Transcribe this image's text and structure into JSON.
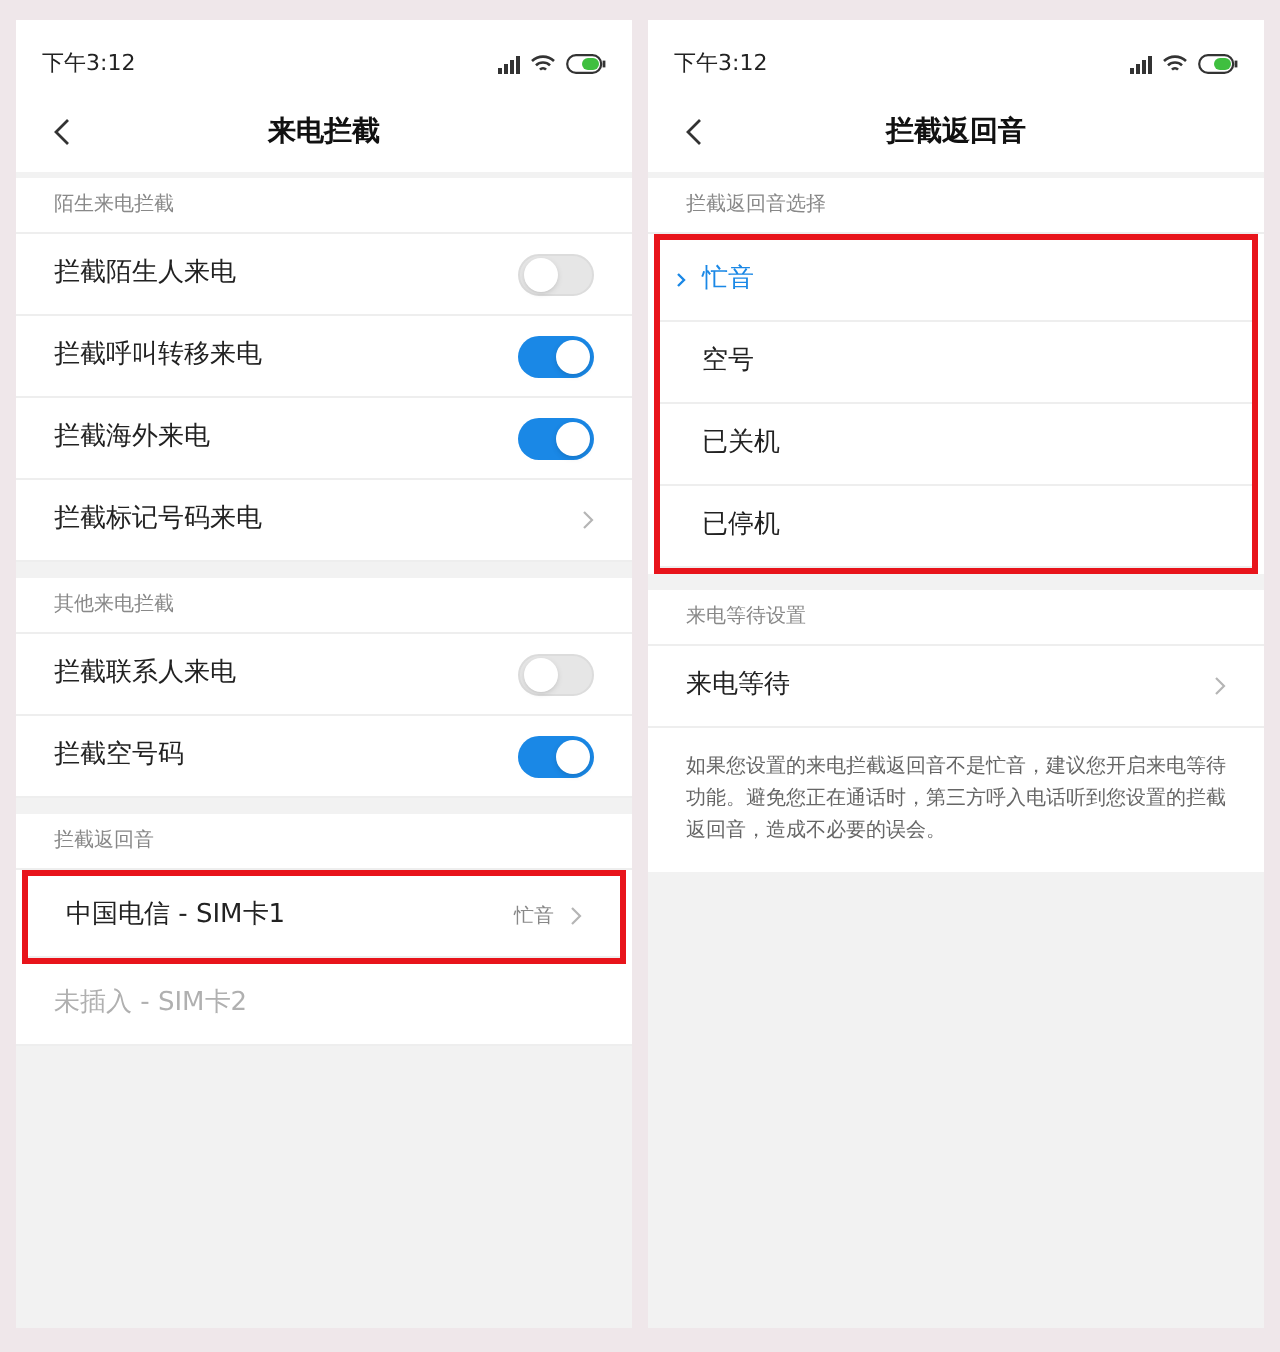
{
  "screens": [
    {
      "status_time": "下午3:12",
      "title": "来电拦截",
      "sections": [
        {
          "header": "陌生来电拦截",
          "items": [
            {
              "kind": "toggle",
              "label": "拦截陌生人来电",
              "on": false
            },
            {
              "kind": "toggle",
              "label": "拦截呼叫转移来电",
              "on": true
            },
            {
              "kind": "toggle",
              "label": "拦截海外来电",
              "on": true
            },
            {
              "kind": "link",
              "label": "拦截标记号码来电"
            }
          ]
        },
        {
          "header": "其他来电拦截",
          "items": [
            {
              "kind": "toggle",
              "label": "拦截联系人来电",
              "on": false
            },
            {
              "kind": "toggle",
              "label": "拦截空号码",
              "on": true
            }
          ]
        },
        {
          "header": "拦截返回音",
          "items": [
            {
              "kind": "link",
              "label": "中国电信 - SIM卡1",
              "value": "忙音",
              "highlighted": true
            },
            {
              "kind": "link",
              "label": "未插入 - SIM卡2",
              "disabled": true
            }
          ]
        }
      ]
    },
    {
      "status_time": "下午3:12",
      "title": "拦截返回音",
      "sections": [
        {
          "header": "拦截返回音选择",
          "highlighted": true,
          "items": [
            {
              "kind": "option",
              "label": "忙音",
              "selected": true
            },
            {
              "kind": "option",
              "label": "空号",
              "selected": false
            },
            {
              "kind": "option",
              "label": "已关机",
              "selected": false
            },
            {
              "kind": "option",
              "label": "已停机",
              "selected": false
            }
          ]
        },
        {
          "header": "来电等待设置",
          "items": [
            {
              "kind": "link",
              "label": "来电等待"
            },
            {
              "kind": "note",
              "label": "如果您设置的来电拦截返回音不是忙音，建议您开启来电等待功能。避免您正在通话时，第三方呼入电话听到您设置的拦截返回音，造成不必要的误会。"
            }
          ]
        }
      ]
    }
  ]
}
